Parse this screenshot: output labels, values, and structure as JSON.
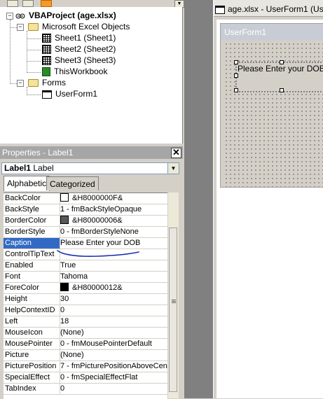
{
  "project": {
    "root": "VBAProject (age.xlsx)",
    "folders": [
      {
        "label": "Microsoft Excel Objects",
        "items": [
          "Sheet1 (Sheet1)",
          "Sheet2 (Sheet2)",
          "Sheet3 (Sheet3)",
          "ThisWorkbook"
        ]
      },
      {
        "label": "Forms",
        "items": [
          "UserForm1"
        ]
      }
    ]
  },
  "properties": {
    "title": "Properties - Label1",
    "close_glyph": "✕",
    "object_name": "Label1",
    "object_type": "Label",
    "tabs": [
      "Alphabetic",
      "Categorized"
    ],
    "rows": [
      {
        "name": "BackColor",
        "value": "&H8000000F&",
        "swatch": "#ffffff"
      },
      {
        "name": "BackStyle",
        "value": "1 - fmBackStyleOpaque"
      },
      {
        "name": "BorderColor",
        "value": "&H80000006&",
        "swatch": "#595959"
      },
      {
        "name": "BorderStyle",
        "value": "0 - fmBorderStyleNone"
      },
      {
        "name": "Caption",
        "value": "Please Enter your DOB",
        "selected": true
      },
      {
        "name": "ControlTipText",
        "value": ""
      },
      {
        "name": "Enabled",
        "value": "True"
      },
      {
        "name": "Font",
        "value": "Tahoma"
      },
      {
        "name": "ForeColor",
        "value": "&H80000012&",
        "swatch": "#000000"
      },
      {
        "name": "Height",
        "value": "30"
      },
      {
        "name": "HelpContextID",
        "value": "0"
      },
      {
        "name": "Left",
        "value": "18"
      },
      {
        "name": "MouseIcon",
        "value": "(None)"
      },
      {
        "name": "MousePointer",
        "value": "0 - fmMousePointerDefault"
      },
      {
        "name": "Picture",
        "value": "(None)"
      },
      {
        "name": "PicturePosition",
        "value": "7 - fmPicturePositionAboveCent"
      },
      {
        "name": "SpecialEffect",
        "value": "0 - fmSpecialEffectFlat"
      },
      {
        "name": "TabIndex",
        "value": "0"
      }
    ]
  },
  "designer": {
    "window_title": "age.xlsx - UserForm1 (Use",
    "form_caption": "UserForm1",
    "label_caption": "Please Enter your DOB"
  },
  "colors": {
    "selection": "#316ac5",
    "annotation_ink": "#1b2fb5"
  }
}
